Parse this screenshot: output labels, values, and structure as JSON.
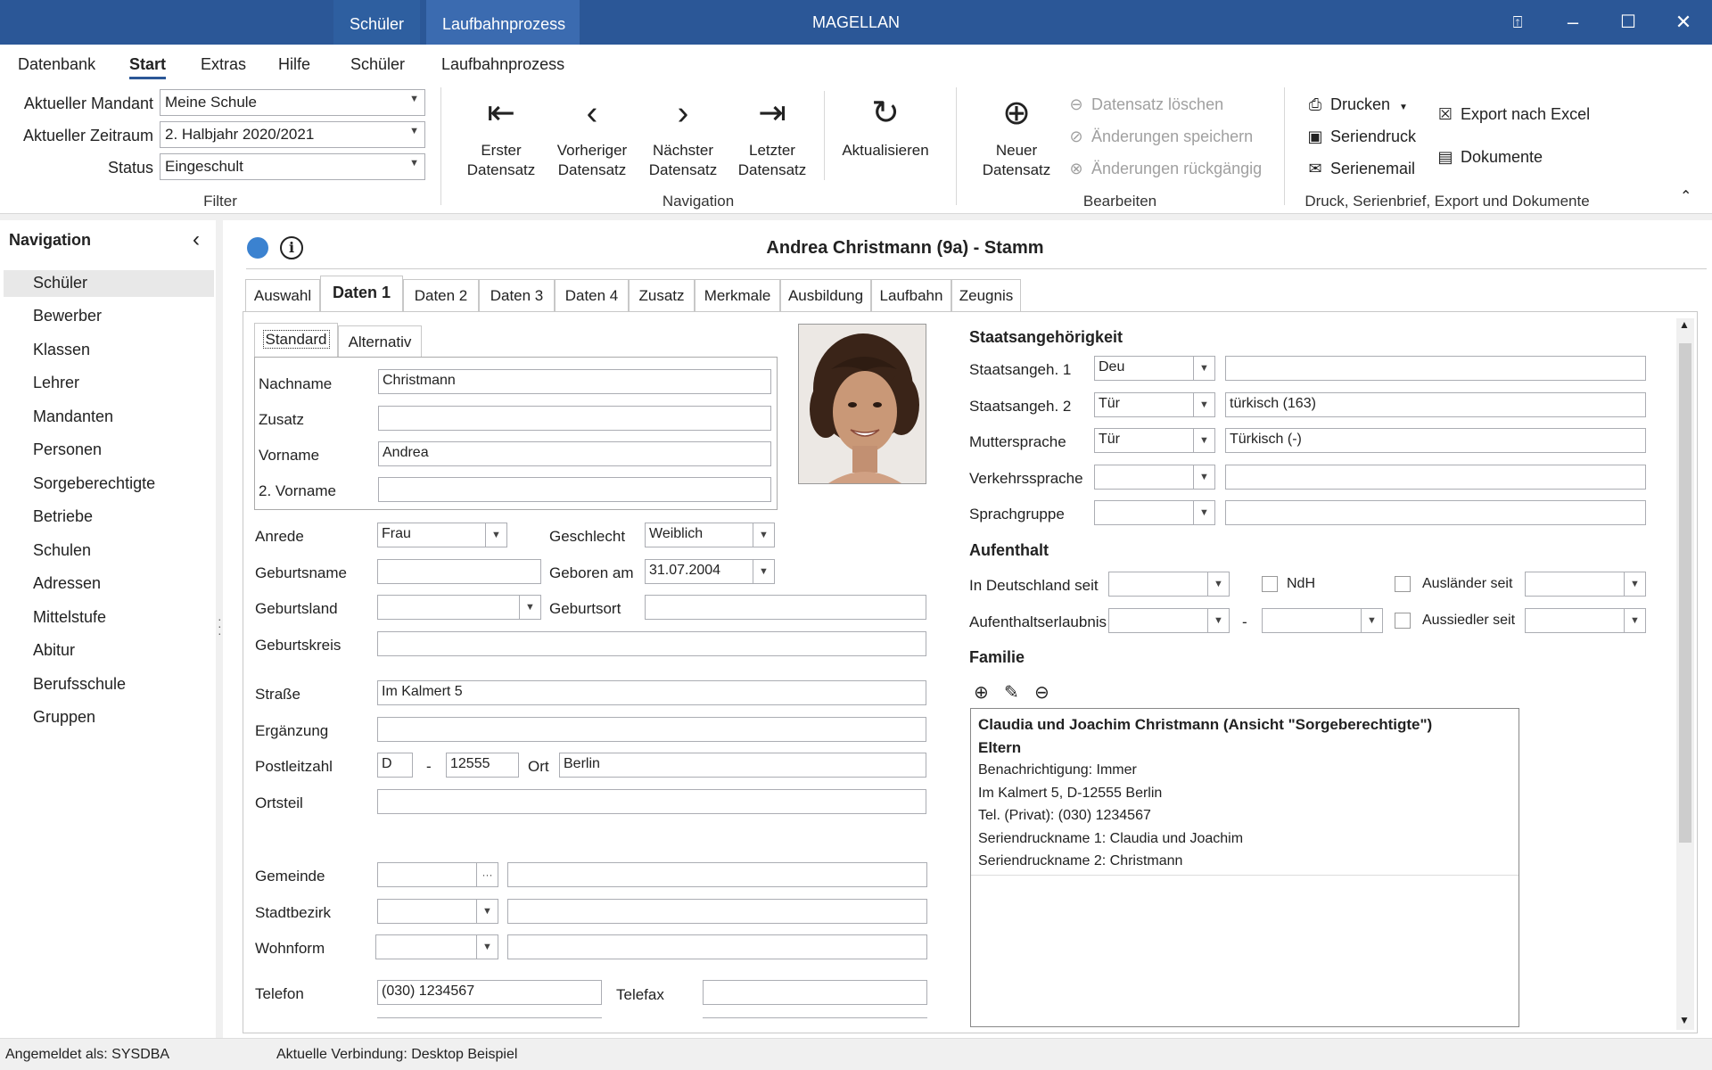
{
  "titlebar": {
    "app_title": "MAGELLAN",
    "context_tabs": [
      "Schüler",
      "Laufbahnprozess"
    ]
  },
  "menu": [
    "Datenbank",
    "Start",
    "Extras",
    "Hilfe",
    "Schüler",
    "Laufbahnprozess"
  ],
  "filter": {
    "mandant_label": "Aktueller Mandant",
    "mandant_value": "Meine Schule",
    "zeitraum_label": "Aktueller Zeitraum",
    "zeitraum_value": "2. Halbjahr 2020/2021",
    "status_label": "Status",
    "status_value": "Eingeschult",
    "group_label": "Filter"
  },
  "navigation_group": {
    "first_1": "Erster",
    "first_2": "Datensatz",
    "prev_1": "Vorheriger",
    "prev_2": "Datensatz",
    "next_1": "Nächster",
    "next_2": "Datensatz",
    "last_1": "Letzter",
    "last_2": "Datensatz",
    "refresh": "Aktualisieren",
    "group_label": "Navigation"
  },
  "bearbeiten": {
    "new_1": "Neuer",
    "new_2": "Datensatz",
    "delete": "Datensatz löschen",
    "save": "Änderungen speichern",
    "undo": "Änderungen rückgängig",
    "group_label": "Bearbeiten"
  },
  "druck": {
    "print": "Drucken",
    "serial": "Seriendruck",
    "email": "Serienemail",
    "excel": "Export nach Excel",
    "docs": "Dokumente",
    "group_label": "Druck, Serienbrief, Export und Dokumente"
  },
  "leftnav": {
    "title": "Navigation",
    "items": [
      "Schüler",
      "Bewerber",
      "Klassen",
      "Lehrer",
      "Mandanten",
      "Personen",
      "Sorgeberechtigte",
      "Betriebe",
      "Schulen",
      "Adressen",
      "Mittelstufe",
      "Abitur",
      "Berufsschule",
      "Gruppen"
    ]
  },
  "record": {
    "title": "Andrea Christmann (9a) - Stamm"
  },
  "tabs": [
    "Auswahl",
    "Daten 1",
    "Daten 2",
    "Daten 3",
    "Daten 4",
    "Zusatz",
    "Merkmale",
    "Ausbildung",
    "Laufbahn",
    "Zeugnis"
  ],
  "subtabs": [
    "Standard",
    "Alternativ"
  ],
  "person": {
    "nachname_label": "Nachname",
    "nachname": "Christmann",
    "zusatz_label": "Zusatz",
    "zusatz": "",
    "vorname_label": "Vorname",
    "vorname": "Andrea",
    "vorname2_label": "2. Vorname",
    "vorname2": "",
    "anrede_label": "Anrede",
    "anrede": "Frau",
    "geschlecht_label": "Geschlecht",
    "geschlecht": "Weiblich",
    "geburtsname_label": "Geburtsname",
    "geburtsname": "",
    "geboren_label": "Geboren am",
    "geboren": "31.07.2004",
    "geburtsland_label": "Geburtsland",
    "geburtsland": "",
    "geburtsort_label": "Geburtsort",
    "geburtsort": "",
    "geburtskreis_label": "Geburtskreis",
    "geburtskreis": ""
  },
  "address": {
    "strasse_label": "Straße",
    "strasse": "Im Kalmert 5",
    "ergaenzung_label": "Ergänzung",
    "ergaenzung": "",
    "plz_label": "Postleitzahl",
    "land": "D",
    "dash": "-",
    "plz": "12555",
    "ort_label": "Ort",
    "ort": "Berlin",
    "ortsteil_label": "Ortsteil",
    "ortsteil": "",
    "gemeinde_label": "Gemeinde",
    "gemeinde": "",
    "ellipsis": "···",
    "stadtbezirk_label": "Stadtbezirk",
    "stadtbezirk": "",
    "wohnform_label": "Wohnform",
    "wohnform": "",
    "telefon_label": "Telefon",
    "telefon": "(030) 1234567",
    "telefax_label": "Telefax",
    "telefax": ""
  },
  "staat": {
    "title": "Staatsangehörigkeit",
    "s1_label": "Staatsangeh. 1",
    "s1_code": "Deu",
    "s1_text": "",
    "s2_label": "Staatsangeh. 2",
    "s2_code": "Tür",
    "s2_text": "türkisch (163)",
    "mutter_label": "Muttersprache",
    "mutter_code": "Tür",
    "mutter_text": "Türkisch (-)",
    "verkehr_label": "Verkehrssprache",
    "verkehr_code": "",
    "verkehr_text": "",
    "gruppe_label": "Sprachgruppe",
    "gruppe_code": "",
    "gruppe_text": ""
  },
  "aufenthalt": {
    "title": "Aufenthalt",
    "seit_label": "In Deutschland seit",
    "ndh_label": "NdH",
    "auslaender_label": "Ausländer seit",
    "erlaubnis_label": "Aufenthaltserlaubnis",
    "dash": "-",
    "aussiedler_label": "Aussiedler seit"
  },
  "familie": {
    "title": "Familie",
    "head": "Claudia und Joachim Christmann (Ansicht \"Sorgeberechtigte\")",
    "role": "Eltern",
    "lines": [
      "Benachrichtigung: Immer",
      "Im Kalmert 5, D-12555 Berlin",
      "Tel. (Privat): (030) 1234567",
      "Seriendruckname 1: Claudia und Joachim",
      "Seriendruckname 2: Christmann"
    ]
  },
  "status": {
    "user": "Angemeldet als: SYSDBA",
    "connection": "Aktuelle Verbindung: Desktop Beispiel"
  }
}
